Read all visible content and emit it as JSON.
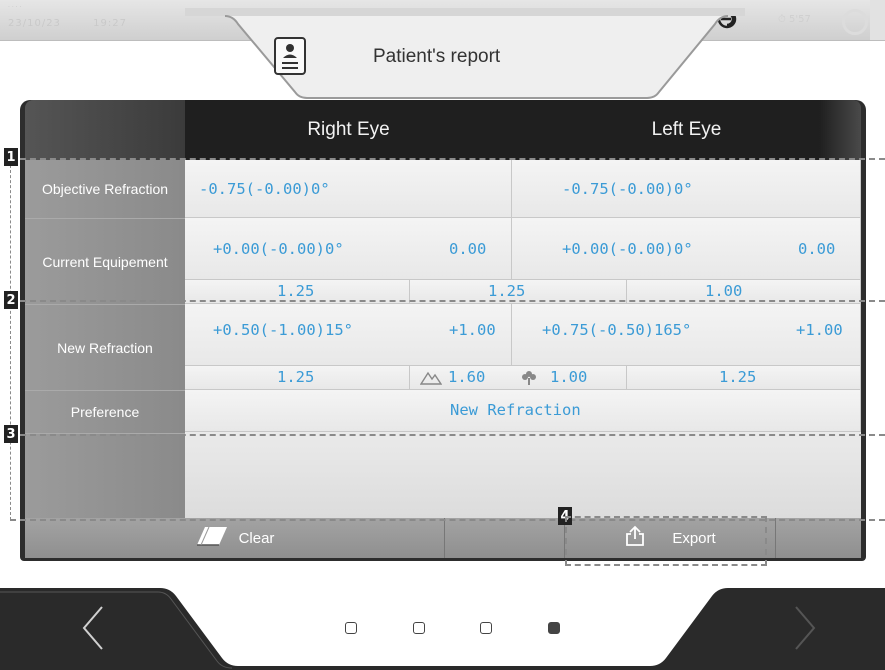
{
  "status": {
    "date": "23/10/23",
    "time": "19:27",
    "timer": "5'57"
  },
  "title": "Patient's report",
  "table": {
    "col_right": "Right Eye",
    "col_left": "Left Eye",
    "rows": {
      "objective": {
        "label": "Objective Refraction",
        "right": "-0.75(-0.00)0°",
        "left": "-0.75(-0.00)0°"
      },
      "current": {
        "label": "Current Equipement",
        "right": "+0.00(-0.00)0°",
        "right_add": "0.00",
        "left": "+0.00(-0.00)0°",
        "left_add": "0.00",
        "va_right": "1.25",
        "va_both": "1.25",
        "va_left": "1.00"
      },
      "new": {
        "label": "New Refraction",
        "right": "+0.50(-1.00)15°",
        "right_add": "+1.00",
        "left": "+0.75(-0.50)165°",
        "left_add": "+1.00",
        "va_right": "1.25",
        "va_far": "1.60",
        "va_near": "1.00",
        "va_left": "1.25"
      },
      "preference": {
        "label": "Preference",
        "value": "New Refraction"
      }
    }
  },
  "footer": {
    "clear": "Clear",
    "export": "Export"
  },
  "markers": [
    "1",
    "2",
    "3",
    "4"
  ],
  "pager": {
    "pages": 4,
    "active": 4
  },
  "colors": {
    "value": "#3b9bd6",
    "panel": "#2d2d2d",
    "label_col": "#9b9b9b"
  }
}
